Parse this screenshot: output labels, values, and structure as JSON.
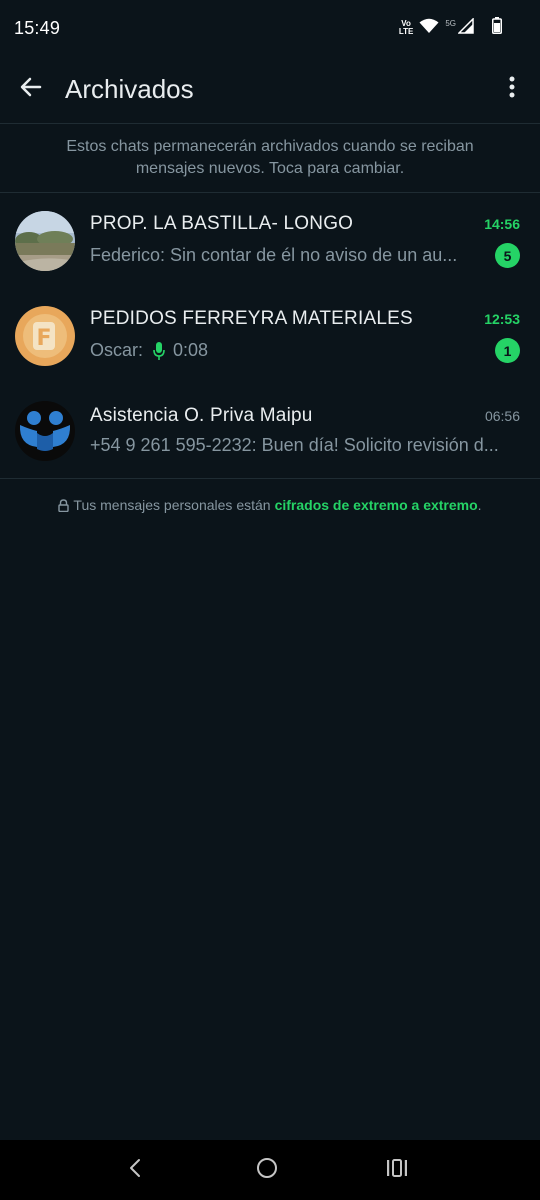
{
  "status_bar": {
    "time": "15:49",
    "volte_top": "Vo",
    "volte_bottom": "LTE",
    "network": "5G",
    "icons": [
      "volte-icon",
      "wifi-icon",
      "signal-icon",
      "battery-icon"
    ]
  },
  "app_bar": {
    "title": "Archivados",
    "back_icon": "arrow-left-icon",
    "more_icon": "more-vertical-icon"
  },
  "info_banner": {
    "text": "Estos chats permanecerán archivados cuando se reciban mensajes nuevos. Toca para cambiar."
  },
  "chats": [
    {
      "name": "PROP. LA BASTILLA- LONGO",
      "time": "14:56",
      "preview": "Federico: Sin contar de él no aviso de un au...",
      "unread_count": "5",
      "avatar": "landscape-photo"
    },
    {
      "name": "PEDIDOS FERREYRA MATERIALES",
      "time": "12:53",
      "preview_sender": "Oscar:",
      "preview_voice_duration": "0:08",
      "unread_count": "1",
      "avatar": "ferreyra-logo",
      "avatar_letter": "F"
    },
    {
      "name": "Asistencia O. Priva Maipu",
      "time": "06:56",
      "preview": "+54 9 261 595-2232: Buen día! Solicito revisión d...",
      "avatar": "blue-figures-logo"
    }
  ],
  "encryption_note": {
    "prefix": "Tus mensajes personales están",
    "link": "cifrados de extremo a extremo",
    "suffix": "."
  },
  "colors": {
    "background": "#0b141a",
    "accent": "#25d366",
    "secondary_text": "#8696a0",
    "primary_text": "#e9edef"
  },
  "nav_bar": {
    "icons": [
      "nav-back-icon",
      "nav-home-icon",
      "nav-recents-icon"
    ]
  }
}
